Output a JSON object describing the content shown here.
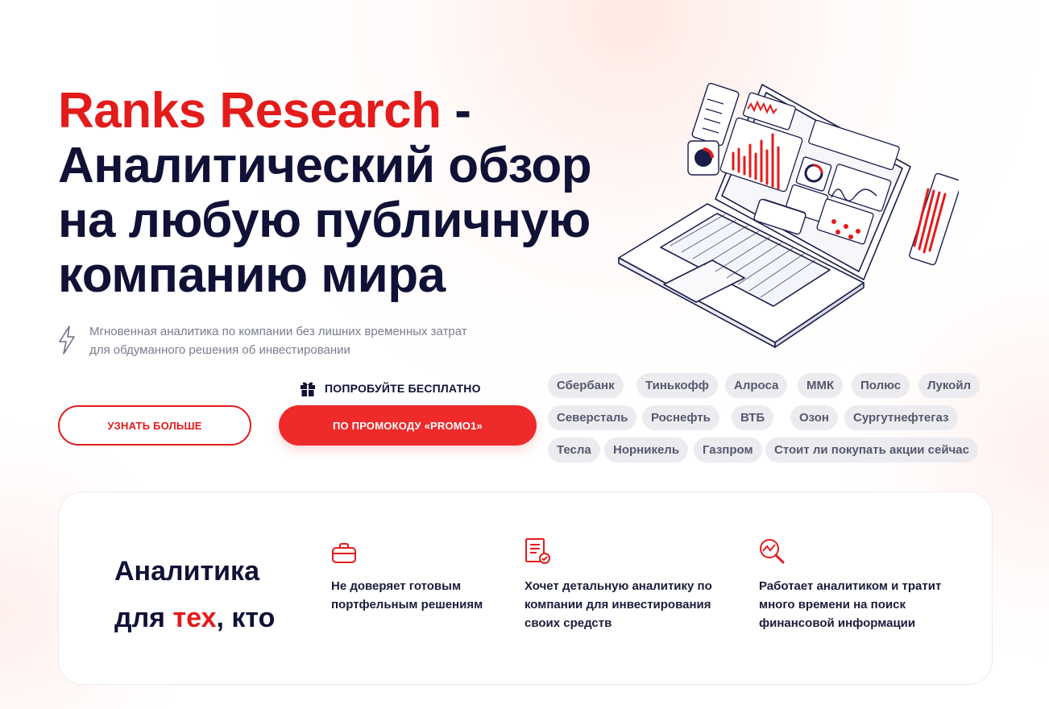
{
  "hero": {
    "brand": "Ranks Research",
    "dash": " -",
    "line2": "Аналитический обзор",
    "line3": "на любую публичную",
    "line4": "компанию мира"
  },
  "subtitle": {
    "line1": "Мгновенная аналитика по компании без лишних временных затрат",
    "line2": "для обдуманного решения об инвестировании",
    "icon": "lightning-icon"
  },
  "buttons": {
    "learn_more": "УЗНАТЬ БОЛЬШЕ",
    "try_free": "ПОПРОБУЙТЕ БЕСПЛАТНО",
    "promo": "ПО ПРОМОКОДУ «PROMO1»"
  },
  "tags": {
    "row1": [
      "Сбербанк",
      "Тинькофф",
      "Алроса",
      "ММК",
      "Полюс",
      "Лукойл"
    ],
    "row2": [
      "Северсталь",
      "Роснефть",
      "ВТБ",
      "Озон",
      "Сургутнефтегаз"
    ],
    "row3": [
      "Тесла",
      "Норникель",
      "Газпром",
      "Стоит ли покупать акции сейчас"
    ]
  },
  "audience": {
    "title_line1": "Аналитика",
    "title_for": "для ",
    "title_red": "тех",
    "title_end": ", кто",
    "features": [
      {
        "icon": "briefcase-icon",
        "lines": [
          "Не доверяет готовым",
          "портфельным решениям"
        ]
      },
      {
        "icon": "report-check-icon",
        "lines": [
          "Хочет детальную аналитику по",
          "компании для инвестирования",
          "своих средств"
        ]
      },
      {
        "icon": "chart-magnifier-icon",
        "lines": [
          "Работает аналитиком и тратит",
          "много времени на поиск",
          "финансовой информации"
        ]
      }
    ]
  },
  "colors": {
    "accent": "#e31b1b",
    "button_red": "#ee2a2a",
    "heading": "#0f1136",
    "tag_bg": "#ececf0"
  }
}
